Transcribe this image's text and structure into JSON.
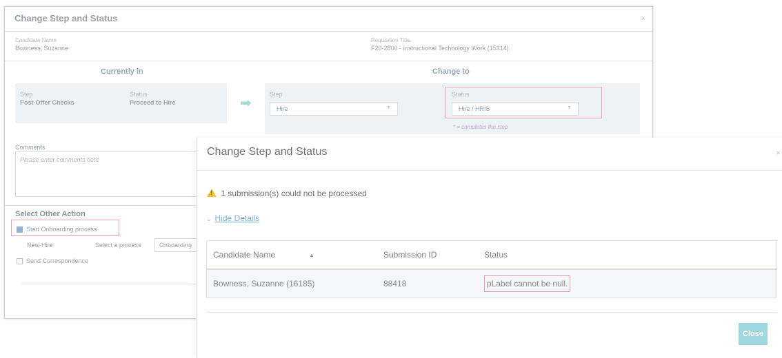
{
  "back_modal": {
    "title": "Change Step and Status",
    "close": "×",
    "candidate_label": "Candidate Name",
    "candidate_value": "Bowness, Suzanne",
    "requisition_label": "Requisition Title",
    "requisition_value": "F20-2800 - Instructional Technology Work (15314)",
    "currently_in_title": "Currently in",
    "change_to_title": "Change to",
    "current_step_label": "Step",
    "current_step_value": "Post-Offer Checks",
    "current_status_label": "Status",
    "current_status_value": "Proceed to Hire",
    "new_step_label": "Step",
    "new_step_value": "Hire",
    "new_status_label": "Status",
    "new_status_value": "Hire / HRIS",
    "completes_hint": "* = completes the step",
    "comments_label": "Comments",
    "comments_placeholder": "Please enter comments here",
    "select_other_action": "Select Other Action",
    "onboarding_checkbox": "Start Onboarding process",
    "new_hire_label": "New-Hire",
    "select_process_label": "Select a process",
    "process_value": "Onboarding",
    "send_correspondence": "Send Correspondence",
    "arrow_icon": "arrow-right-icon",
    "caret_icon": "chevron-down-icon"
  },
  "front_modal": {
    "title": "Change Step and Status",
    "close": "×",
    "warning_text": "1 submission(s) could not be processed",
    "warning_icon": "warning-icon",
    "hide_details": "Hide Details",
    "chevron": "⌄",
    "columns": [
      "Candidate Name",
      "Submission ID",
      "Status"
    ],
    "sort_glyph": "▲",
    "rows": [
      {
        "candidate": "Bowness, Suzanne (16185)",
        "submission_id": "88418",
        "status": "pLabel cannot be null."
      }
    ],
    "close_button": "Close"
  },
  "colors": {
    "accent_teal": "#9fd7df",
    "link_blue": "#7fb3dc",
    "highlight_red": "#e8a3b0",
    "warning_yellow": "#f2c12e"
  }
}
